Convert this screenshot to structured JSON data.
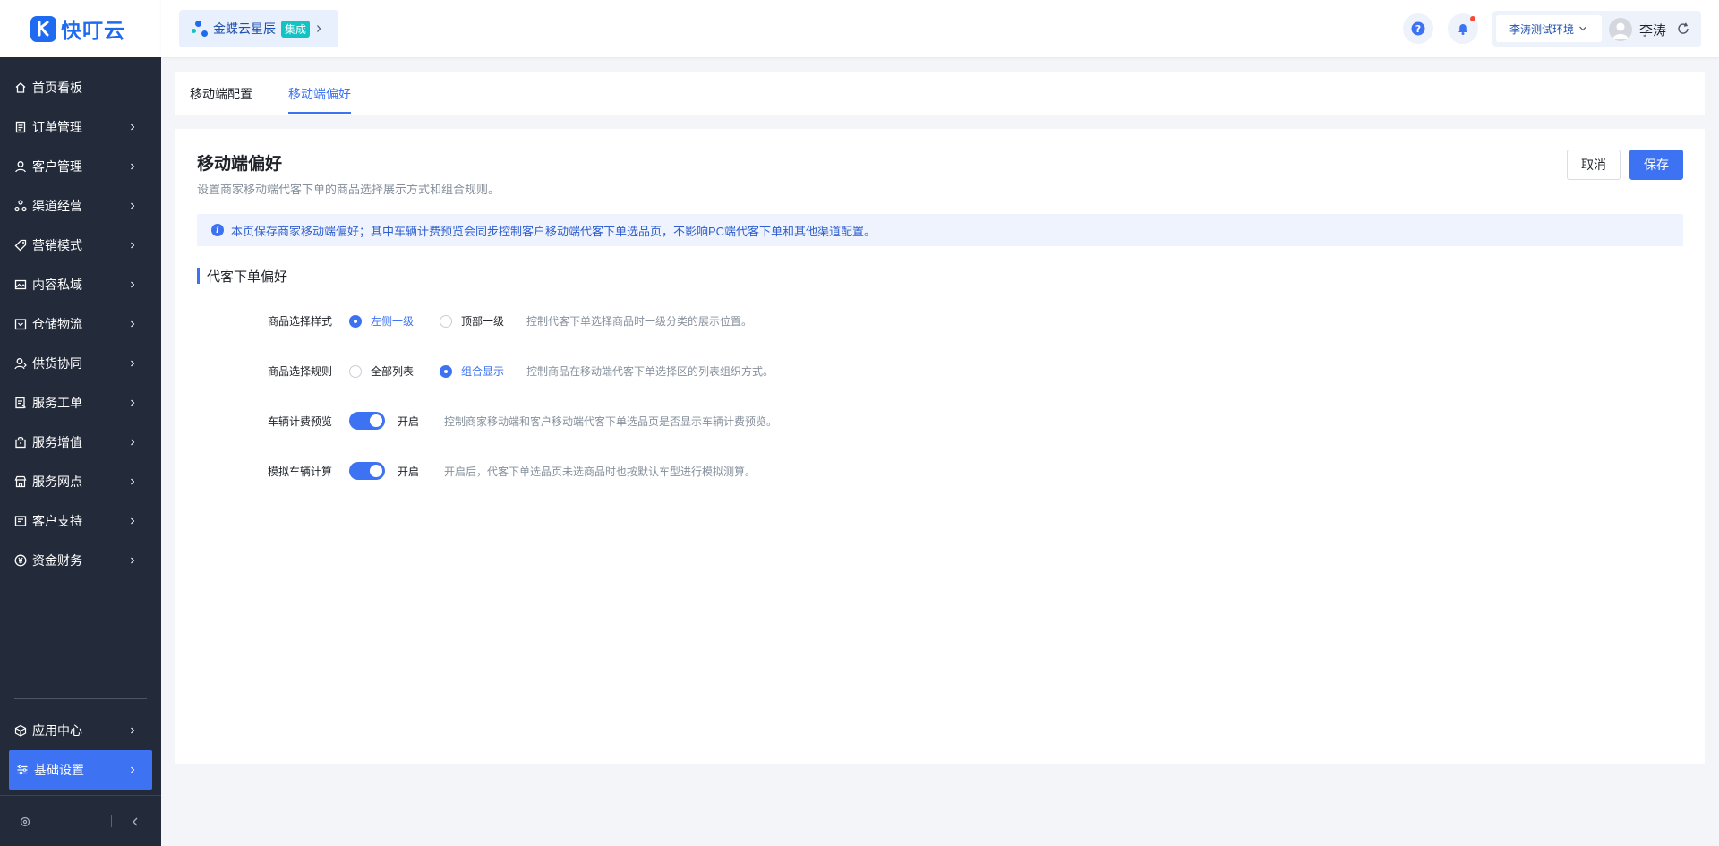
{
  "app": {
    "logo_text": "快叮云"
  },
  "sidebar": {
    "items": [
      {
        "label": "首页看板",
        "icon": "home-icon"
      },
      {
        "label": "订单管理",
        "icon": "order-icon"
      },
      {
        "label": "客户管理",
        "icon": "user-icon"
      },
      {
        "label": "渠道经营",
        "icon": "channel-icon"
      },
      {
        "label": "营销模式",
        "icon": "tag-icon"
      },
      {
        "label": "内容私域",
        "icon": "image-icon"
      },
      {
        "label": "仓储物流",
        "icon": "warehouse-icon"
      },
      {
        "label": "供货协同",
        "icon": "supply-icon"
      },
      {
        "label": "服务工单",
        "icon": "ticket-icon"
      },
      {
        "label": "服务增值",
        "icon": "bag-icon"
      },
      {
        "label": "服务网点",
        "icon": "store-icon"
      },
      {
        "label": "客户支持",
        "icon": "support-icon"
      },
      {
        "label": "资金财务",
        "icon": "yuan-icon"
      }
    ],
    "bottom_items": [
      {
        "label": "应用中心",
        "icon": "cube-icon"
      },
      {
        "label": "基础设置",
        "icon": "settings-sliders-icon"
      }
    ]
  },
  "topbar": {
    "brand_name": "金蝶云星辰",
    "brand_tag": "集成",
    "environment": "李涛测试环境",
    "user_name": "李涛"
  },
  "tabs": [
    {
      "label": "移动端配置",
      "active": false
    },
    {
      "label": "移动端偏好",
      "active": true
    }
  ],
  "page": {
    "title": "移动端偏好",
    "description": "设置商家移动端代客下单的商品选择展示方式和组合规则。",
    "cancel_label": "取消",
    "save_label": "保存",
    "info": "本页保存商家移动端偏好；其中车辆计费预览会同步控制客户移动端代客下单选品页，不影响PC端代客下单和其他渠道配置。",
    "section_title": "代客下单偏好",
    "fields": {
      "style": {
        "label": "商品选择样式",
        "options": [
          "左侧一级",
          "顶部一级"
        ],
        "selected": "左侧一级",
        "hint": "控制代客下单选择商品时一级分类的展示位置。"
      },
      "rule": {
        "label": "商品选择规则",
        "options": [
          "全部列表",
          "组合显示"
        ],
        "selected": "组合显示",
        "hint": "控制商品在移动端代客下单选择区的列表组织方式。"
      },
      "vehicle_preview": {
        "label": "车辆计费预览",
        "state": "开启",
        "hint": "控制商家移动端和客户移动端代客下单选品页是否显示车辆计费预览。"
      },
      "vehicle_calc": {
        "label": "模拟车辆计算",
        "state": "开启",
        "hint": "开启后，代客下单选品页未选商品时也按默认车型进行模拟测算。"
      }
    }
  },
  "colors": {
    "primary": "#3d73f2",
    "sidebar_bg": "#232b3b",
    "brand_blue": "#1e6bf2"
  }
}
